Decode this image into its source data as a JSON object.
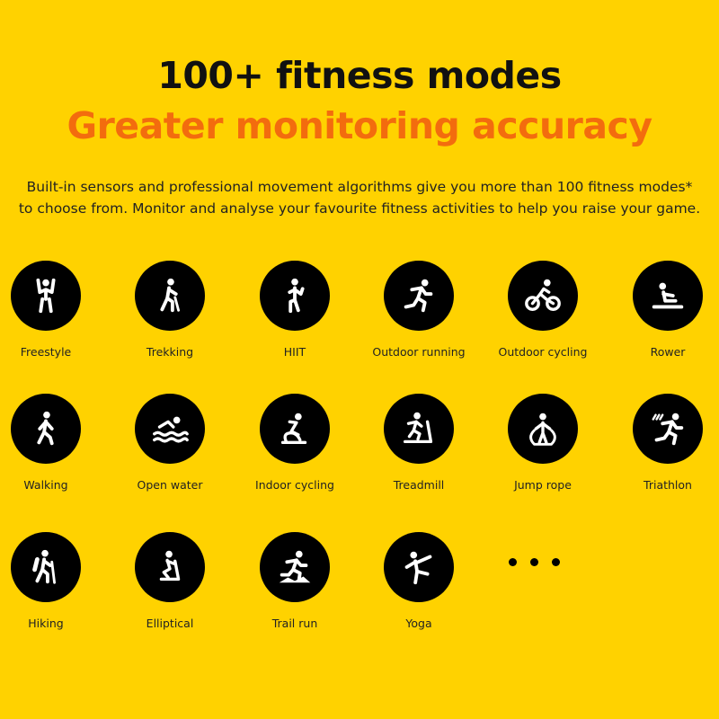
{
  "header": {
    "title": "100+ fitness modes",
    "subtitle": "Greater monitoring accuracy",
    "accent_color": "#F36C0E",
    "description": "Built-in sensors and professional movement algorithms give you more than 100 fitness modes* to choose from. Monitor and analyse your favourite fitness activities to help you raise your game."
  },
  "modes": [
    {
      "label": "Freestyle",
      "icon": "freestyle-icon"
    },
    {
      "label": "Trekking",
      "icon": "trekking-icon"
    },
    {
      "label": "HIIT",
      "icon": "hiit-icon"
    },
    {
      "label": "Outdoor running",
      "icon": "outdoor-running-icon"
    },
    {
      "label": "Outdoor cycling",
      "icon": "outdoor-cycling-icon"
    },
    {
      "label": "Rower",
      "icon": "rower-icon"
    },
    {
      "label": "Walking",
      "icon": "walking-icon"
    },
    {
      "label": "Open water",
      "icon": "open-water-icon"
    },
    {
      "label": "Indoor cycling",
      "icon": "indoor-cycling-icon"
    },
    {
      "label": "Treadmill",
      "icon": "treadmill-icon"
    },
    {
      "label": "Jump rope",
      "icon": "jump-rope-icon"
    },
    {
      "label": "Triathlon",
      "icon": "triathlon-icon"
    },
    {
      "label": "Hiking",
      "icon": "hiking-icon"
    },
    {
      "label": "Elliptical",
      "icon": "elliptical-icon"
    },
    {
      "label": "Trail run",
      "icon": "trail-run-icon"
    },
    {
      "label": "Yoga",
      "icon": "yoga-icon"
    }
  ],
  "more_indicator": "more-icon"
}
